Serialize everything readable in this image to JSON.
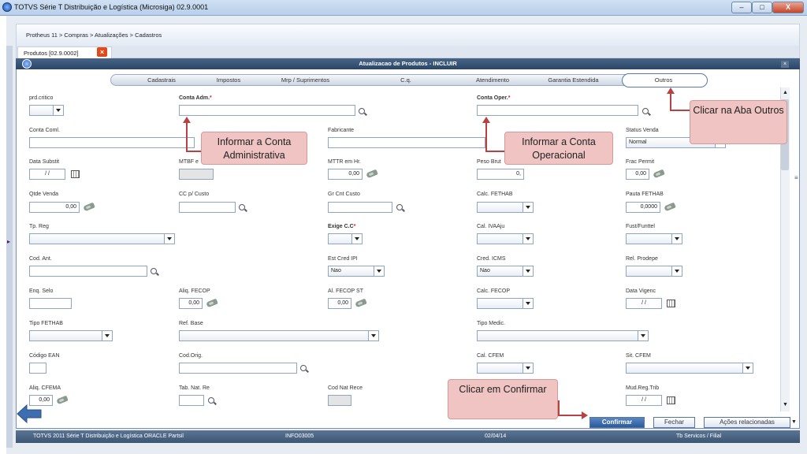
{
  "window": {
    "title": "TOTVS Série T Distribuição e Logística (Microsiga) 02.9.0001",
    "min": "–",
    "max": "□",
    "close": "X"
  },
  "breadcrumb": "Protheus 11 > Compras  > Atualizações > Cadastros",
  "doc_tab": {
    "label": "Produtos [02.9.0002]",
    "close": "×"
  },
  "dialog": {
    "title": "Atualizacao de Produtos - INCLUIR",
    "close": "×"
  },
  "tabs": [
    "Cadastrais",
    "Impostos",
    "Mrp / Suprimentos",
    "C.q.",
    "Atendimento",
    "Garantia Estendida",
    "Outros"
  ],
  "fields": {
    "prd_critico": "prd.critico",
    "conta_adm": "Conta Adm.",
    "conta_oper": "Conta Oper.",
    "req": "*",
    "conta_coml": "Conta Coml.",
    "fabricante": "Fabricante",
    "status_venda": "Status Venda",
    "status_venda_val": "Normal",
    "data_subst": "Data Substit",
    "data_subst_val": "/ /",
    "mtbf": "MTBF e",
    "mttr": "MTTR em Hr.",
    "mttr_val": "0,00",
    "peso_brut": "Peso Brut",
    "peso_brut_val": "0,",
    "frac_permit": "Frac Permit",
    "frac_permit_val": "0,00",
    "qtde_venda": "Qtde Venda",
    "qtde_venda_val": "0,00",
    "cc_custo": "CC p/ Custo",
    "gr_cnt_custo": "Gr Cnt Custo",
    "calc_fethab": "Calc. FETHAB",
    "pauta_fethab": "Pauta FETHAB",
    "pauta_fethab_val": "0,0000",
    "tp_reg": "Tp. Reg",
    "exige_cc": "Exige C.C",
    "cal_ivaaju": "Cal. IVAAju",
    "fust": "Fust/Funttel",
    "cod_ant": "Cod. Ant.",
    "est_cred_ipi": "Est Cred IPI",
    "est_cred_ipi_val": "Nao",
    "cred_icms": "Cred. ICMS",
    "cred_icms_val": "Nao",
    "rel_prodepe": "Rel. Prodepe",
    "enq_selo": "Enq. Selo",
    "aliq_fecop": "Aliq. FECOP",
    "aliq_fecop_val": "0,00",
    "al_fecop_st": "Al. FECOP ST",
    "al_fecop_st_val": "0,00",
    "calc_fecop": "Calc. FECOP",
    "data_vigenc": "Data Vigenc",
    "data_vigenc_val": "/ /",
    "tipo_fethab": "Tipo FETHAB",
    "ref_base": "Ref. Base",
    "tipo_medic": "Tipo Medic.",
    "codigo_ean": "Código EAN",
    "cod_orig": "Cod.Orig.",
    "cal_cfem": "Cal. CFEM",
    "sit_cfem": "Sit. CFEM",
    "aliq_cfema": "Aliq. CFEMA",
    "aliq_cfema_val": "0,00",
    "tab_nat_re": "Tab. Nat. Re",
    "cod_nat_rece": "Cod Nat Rece",
    "mud_reg_trib": "Mud.Reg.Trib",
    "mud_reg_trib_val": "/ /"
  },
  "callouts": {
    "conta_adm": "Informar a Conta Administrativa",
    "conta_oper": "Informar a Conta Operacional",
    "aba_outros": "Clicar na Aba Outros",
    "confirmar": "Clicar em Confirmar"
  },
  "buttons": {
    "confirmar": "Confirmar",
    "fechar": "Fechar",
    "acoes": "Ações relacionadas"
  },
  "status": {
    "app": "TOTVS 2011 Série T Distribuição e Logística ORACLE Partsil",
    "env": "INFO03005",
    "date": "02/04/14",
    "company": "Tb Servicos / Filial"
  },
  "colors": {
    "callout": "#efc4c2",
    "accent": "#2b4566",
    "arrow": "#b84242",
    "blue_arrow": "#3d6fb0"
  }
}
